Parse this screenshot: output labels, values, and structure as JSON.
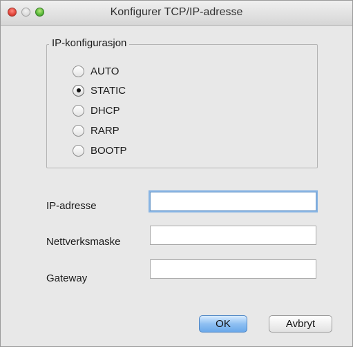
{
  "window": {
    "title": "Konfigurer TCP/IP-adresse"
  },
  "ip_config": {
    "group_label": "IP-konfigurasjon",
    "options": [
      {
        "label": "AUTO",
        "checked": false
      },
      {
        "label": "STATIC",
        "checked": true
      },
      {
        "label": "DHCP",
        "checked": false
      },
      {
        "label": "RARP",
        "checked": false
      },
      {
        "label": "BOOTP",
        "checked": false
      }
    ]
  },
  "fields": {
    "ip_address": {
      "label": "IP-adresse",
      "value": ""
    },
    "netmask": {
      "label": "Nettverksmaske",
      "value": ""
    },
    "gateway": {
      "label": "Gateway",
      "value": ""
    }
  },
  "buttons": {
    "ok": "OK",
    "cancel": "Avbryt"
  },
  "colors": {
    "close": "#e0443a",
    "zoom": "#58b83a",
    "focus_ring": "#86b3e3",
    "primary_button": "#8fc0f2"
  }
}
